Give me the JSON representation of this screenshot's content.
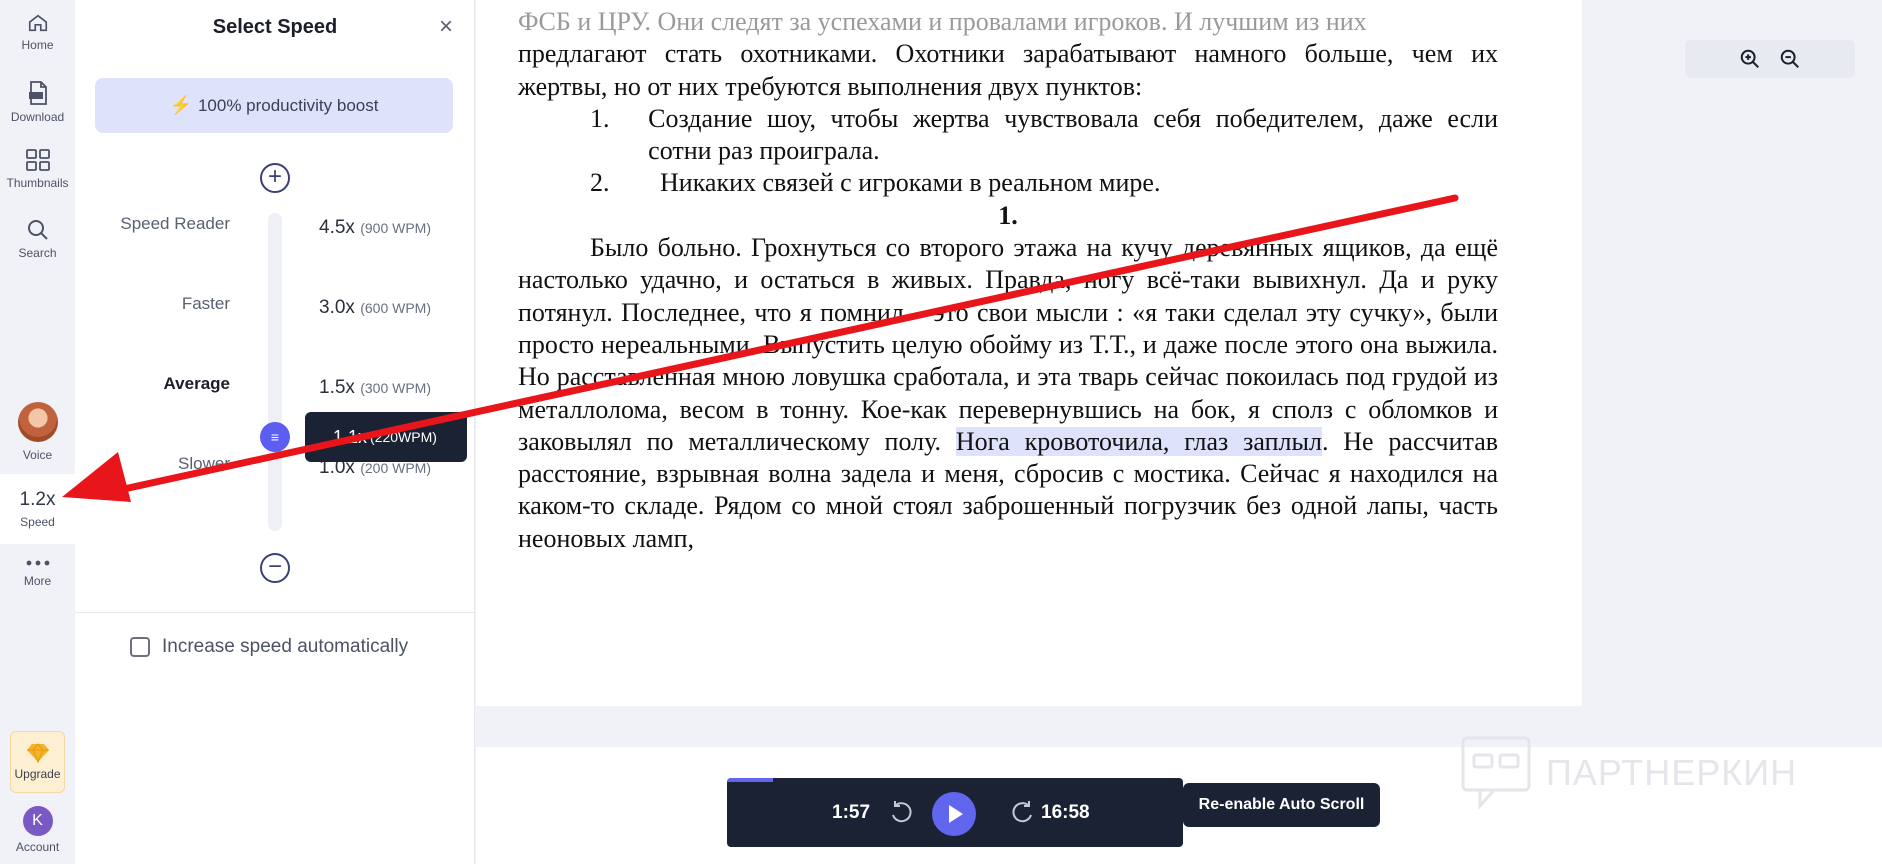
{
  "rail": {
    "home": "Home",
    "download": "Download",
    "thumbnails": "Thumbnails",
    "search": "Search",
    "voice": "Voice",
    "speed_value": "1.2x",
    "speed": "Speed",
    "more": "More",
    "upgrade": "Upgrade",
    "account_initial": "K",
    "account": "Account"
  },
  "panel": {
    "title": "Select Speed",
    "boost": "100% productivity boost",
    "levels": [
      {
        "label": "Speed Reader",
        "value": "4.5x",
        "wpm": "(900 WPM)"
      },
      {
        "label": "Faster",
        "value": "3.0x",
        "wpm": "(600 WPM)"
      },
      {
        "label": "Average",
        "value": "1.5x",
        "wpm": "(300 WPM)"
      },
      {
        "label": "Slower",
        "value": "1.0x",
        "wpm": "(200 WPM)"
      }
    ],
    "current_value": "1.1x",
    "current_wpm": "(220WPM)",
    "auto_label": "Increase speed automatically"
  },
  "document": {
    "line0": "ФСБ и ЦРУ. Они следят за успехами и провалами игроков. И лучшим из них",
    "para1": "предлагают стать охотниками. Охотники зарабатывают намного больше, чем их жертвы, но от них требуются выполнения двух пунктов:",
    "item1_num": "1.",
    "item1": "Создание шоу, чтобы жертва чувствовала себя победителем, даже если сотни раз проиграла.",
    "item2_num": "2.",
    "item2": "Никаких связей с игроками в реальном мире.",
    "chapter": "1.",
    "para2_before": "Было больно. Грохнуться со второго этажа на кучу деревянных ящиков, да ещё настолько удачно, и остаться в живых. Правда, ногу всё-таки вывихнул. Да и руку потянул. Последнее, что я помнил – это свои мысли : «я таки сделал эту сучку», были просто нереальными. Выпустить целую обойму из Т.Т., и даже после этого она выжила. Но расставленная мною ловушка сработала, и эта тварь сейчас покоилась под грудой из металлолома, весом в тонну. Кое-как перевернувшись на бок, я сполз с обломков и заковылял по металлическому полу.",
    "para2_highlight": "Нога кровоточила, глаз заплыл",
    "para2_after": ". Не рассчитав расстояние, взрывная волна задела и меня, сбросив с мостика. Сейчас я находился на каком-то складе. Рядом со мной стоял заброшенный погрузчик без одной лапы, часть неоновых ламп,"
  },
  "player": {
    "elapsed": "1:57",
    "remaining": "16:58",
    "progress_fraction": 0.1,
    "accent": "#6166ee"
  },
  "resume_label": "Re-enable Auto Scroll",
  "watermark": "ПАРТНЕРКИН",
  "annotation_color": "#e8151b"
}
